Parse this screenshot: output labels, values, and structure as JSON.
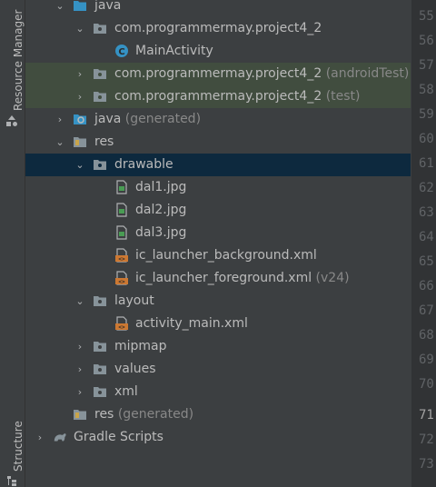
{
  "side_tabs": {
    "resource_manager": "Resource Manager",
    "structure": "Structure"
  },
  "tree": [
    {
      "label": "java",
      "suffix": ""
    },
    {
      "label": "com.programmermay.project4_2",
      "suffix": ""
    },
    {
      "label": "MainActivity",
      "suffix": ""
    },
    {
      "label": "com.programmermay.project4_2",
      "suffix": "(androidTest)"
    },
    {
      "label": "com.programmermay.project4_2",
      "suffix": "(test)"
    },
    {
      "label": "java",
      "suffix": "(generated)"
    },
    {
      "label": "res",
      "suffix": ""
    },
    {
      "label": "drawable",
      "suffix": ""
    },
    {
      "label": "dal1.jpg",
      "suffix": ""
    },
    {
      "label": "dal2.jpg",
      "suffix": ""
    },
    {
      "label": "dal3.jpg",
      "suffix": ""
    },
    {
      "label": "ic_launcher_background.xml",
      "suffix": ""
    },
    {
      "label": "ic_launcher_foreground.xml",
      "suffix": "(v24)"
    },
    {
      "label": "layout",
      "suffix": ""
    },
    {
      "label": "activity_main.xml",
      "suffix": ""
    },
    {
      "label": "mipmap",
      "suffix": ""
    },
    {
      "label": "values",
      "suffix": ""
    },
    {
      "label": "xml",
      "suffix": ""
    },
    {
      "label": "res",
      "suffix": "(generated)"
    },
    {
      "label": "Gradle Scripts",
      "suffix": ""
    }
  ],
  "line_numbers": [
    "55",
    "56",
    "57",
    "58",
    "59",
    "60",
    "61",
    "62",
    "63",
    "64",
    "65",
    "66",
    "67",
    "68",
    "69",
    "70",
    "71",
    "72",
    "73"
  ],
  "colors": {
    "selection": "#0d293e",
    "test_highlight": "#414d3f",
    "folder": "#87939a",
    "class_icon": "#3592c4",
    "xml_icon": "#cc7832",
    "image_icon": "#499c54"
  }
}
